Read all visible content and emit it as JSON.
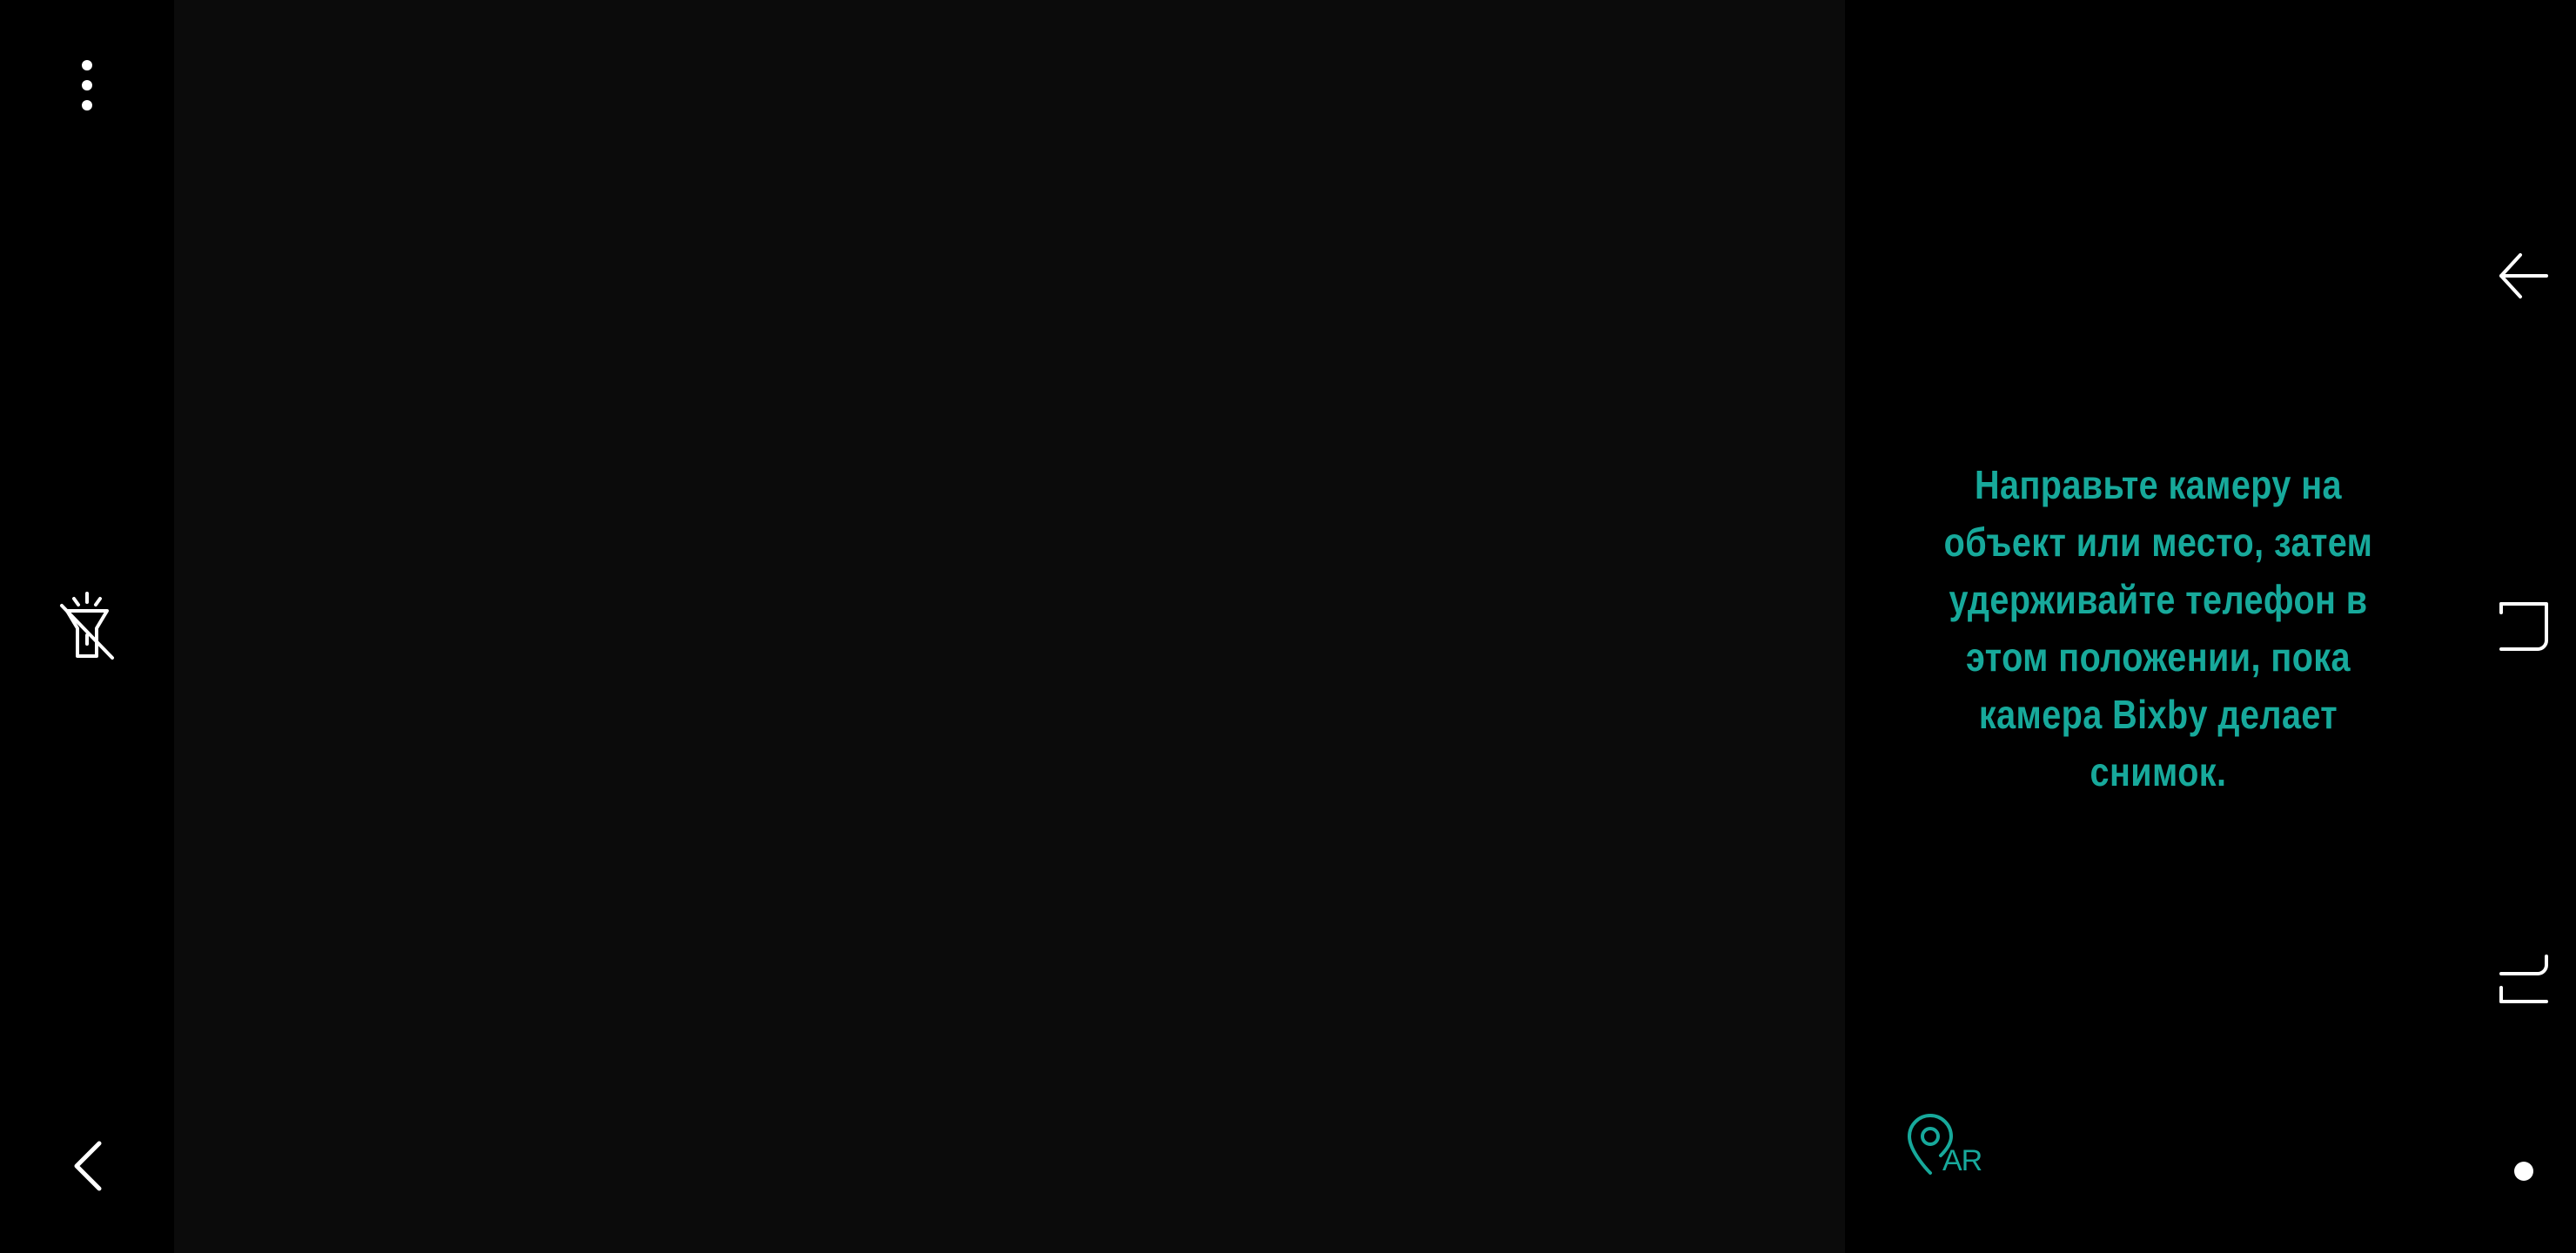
{
  "left_bar": {
    "more_icon": "more-vertical-icon",
    "flash_icon": "flash-off-icon",
    "back_icon": "chevron-left-icon"
  },
  "viewfinder": {
    "background": "#0b0b0b"
  },
  "info_panel": {
    "hint_lines": [
      "Направьте камеру на",
      "объект или место, затем",
      "удерживайте телефон в",
      "этом положении, пока",
      "камера Bixby делает",
      "снимок."
    ],
    "accent_color": "#17a99b",
    "ar_button": {
      "icon": "location-pin-icon",
      "label": "AR"
    }
  },
  "nav_bar": {
    "back_icon": "nav-back-icon",
    "home_icon": "nav-home-icon",
    "recents_icon": "nav-recents-icon",
    "dot_icon": "nav-dot-icon"
  }
}
